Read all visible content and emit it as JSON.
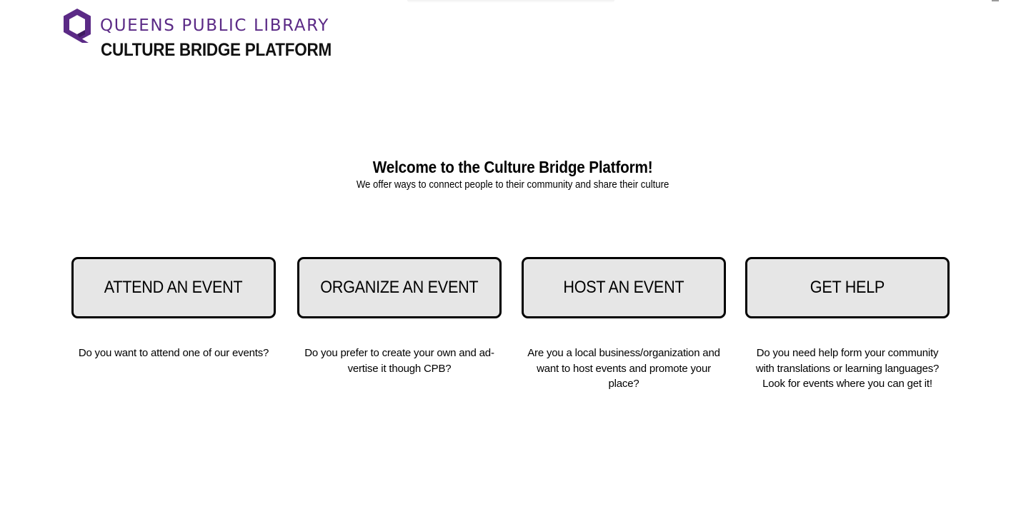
{
  "header": {
    "library_name": "QUEENS PUBLIC LIBRARY",
    "platform_name": "CULTURE BRIDGE PLATFORM",
    "logo_icon": "queens-library-q-logo",
    "brand_color": "#5b2a86"
  },
  "welcome": {
    "title": "Welcome to the Culture Bridge Platform!",
    "subtitle": "We offer ways to connect people to their community and share their culture"
  },
  "options": [
    {
      "label": "ATTEND AN EVENT",
      "description": "Do you want to attend one of our events?"
    },
    {
      "label": "ORGANIZE AN EVENT",
      "description": "Do you prefer  to create your own and ad-vertise it though CPB?"
    },
    {
      "label": "HOST AN EVENT",
      "description": "Are you a local business/organization and want to host events and promote your place?"
    },
    {
      "label": "GET HELP",
      "description": "Do you need help form your community with translations or learning languages? Look for events where you can get it!"
    }
  ],
  "colors": {
    "button_bg": "#e6e6e6",
    "button_border": "#000000",
    "page_bg": "#ffffff"
  }
}
